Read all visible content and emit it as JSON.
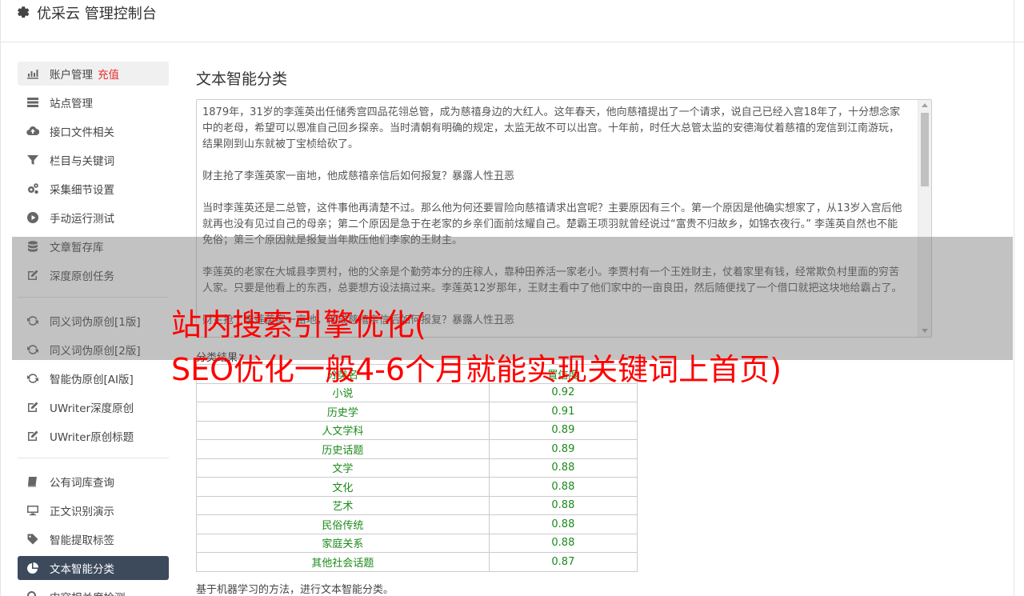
{
  "app": {
    "title": "优采云 管理控制台",
    "icon": "gear-icon"
  },
  "sidebar": {
    "groups": [
      [
        {
          "label": "账户管理",
          "badge": "充值",
          "icon": "bar-chart-icon"
        },
        {
          "label": "站点管理",
          "icon": "server-icon"
        },
        {
          "label": "接口文件相关",
          "icon": "cloud-upload-icon"
        },
        {
          "label": "栏目与关键词",
          "icon": "filter-icon"
        },
        {
          "label": "采集细节设置",
          "icon": "cogs-icon"
        },
        {
          "label": "手动运行测试",
          "icon": "play-circle-icon"
        },
        {
          "label": "文章暂存库",
          "icon": "database-icon"
        },
        {
          "label": "深度原创任务",
          "icon": "edit-icon"
        }
      ],
      [
        {
          "label": "同义词伪原创[1版]",
          "icon": "refresh-icon"
        },
        {
          "label": "同义词伪原创[2版]",
          "icon": "refresh-icon"
        },
        {
          "label": "智能伪原创[AI版]",
          "icon": "refresh-icon"
        },
        {
          "label": "UWriter深度原创",
          "icon": "edit-icon"
        },
        {
          "label": "UWriter原创标题",
          "icon": "edit-icon"
        }
      ],
      [
        {
          "label": "公有词库查询",
          "icon": "book-icon"
        },
        {
          "label": "正文识别演示",
          "icon": "desktop-icon"
        },
        {
          "label": "智能提取标签",
          "icon": "tag-icon"
        },
        {
          "label": "文本智能分类",
          "icon": "pie-chart-icon"
        },
        {
          "label": "内容相关度检测",
          "icon": "search-icon"
        }
      ]
    ]
  },
  "main": {
    "title": "文本智能分类",
    "text_content": [
      "1879年，31岁的李莲英出任储秀宫四品花翎总管，成为慈禧身边的大红人。这年春天，他向慈禧提出了一个请求，说自己已经入宫18年了，十分想念家中的老母，希望可以恩准自己回乡探亲。当时清朝有明确的规定，太监无故不可以出宫。十年前，时任大总管太监的安德海仗着慈禧的宠信到江南游玩，结果刚到山东就被丁宝桢给砍了。",
      "财主抢了李莲英家一亩地，他成慈禧亲信后如何报复？暴露人性丑恶",
      "当时李莲英还是二总管，这件事他再清楚不过。那么他为何还要冒险向慈禧请求出宫呢？主要原因有三个。第一个原因是他确实想家了，从13岁入宫后他就再也没有见过自己的母亲；第二个原因是急于在老家的乡亲们面前炫耀自己。楚霸王项羽就曾经说过“富贵不归故乡，如锦衣夜行。” 李莲英自然也不能免俗；第三个原因就是报复当年欺压他们李家的王财主。",
      "李莲英的老家在大城县李贾村，他的父亲是个勤劳本分的庄稼人，靠种田养活一家老小。李贾村有一个王姓财主，仗着家里有钱，经常欺负村里面的穷苦人家。只要是他看上的东西，总要想方设法搞过来。李莲英12岁那年，王财主看中了他们家中的一亩良田，然后随便找了一个借口就把这块地给霸占了。",
      "财主抢了李莲英家一亩地，他成慈禧亲信后如何报复？暴露人性丑恶"
    ],
    "result_label": "分类结果：",
    "table_headers": [
      "分类名",
      "置信度"
    ],
    "table_rows": [
      [
        "小说",
        "0.92"
      ],
      [
        "历史学",
        "0.91"
      ],
      [
        "人文学科",
        "0.89"
      ],
      [
        "历史话题",
        "0.89"
      ],
      [
        "文学",
        "0.88"
      ],
      [
        "文化",
        "0.88"
      ],
      [
        "艺术",
        "0.88"
      ],
      [
        "民俗传统",
        "0.88"
      ],
      [
        "家庭关系",
        "0.88"
      ],
      [
        "其他社会话题",
        "0.87"
      ]
    ],
    "footer_note": "基于机器学习的方法，进行文本智能分类。"
  },
  "overlay": {
    "line1": "站内搜索引擎优化(",
    "line2": "SEO优化一般4-6个月就能实现关键词上首页)"
  },
  "colors": {
    "active_nav": "#3c4a5c",
    "badge": "#e62e2e",
    "table_text": "#1a8a1a",
    "headline": "#ff0000"
  }
}
